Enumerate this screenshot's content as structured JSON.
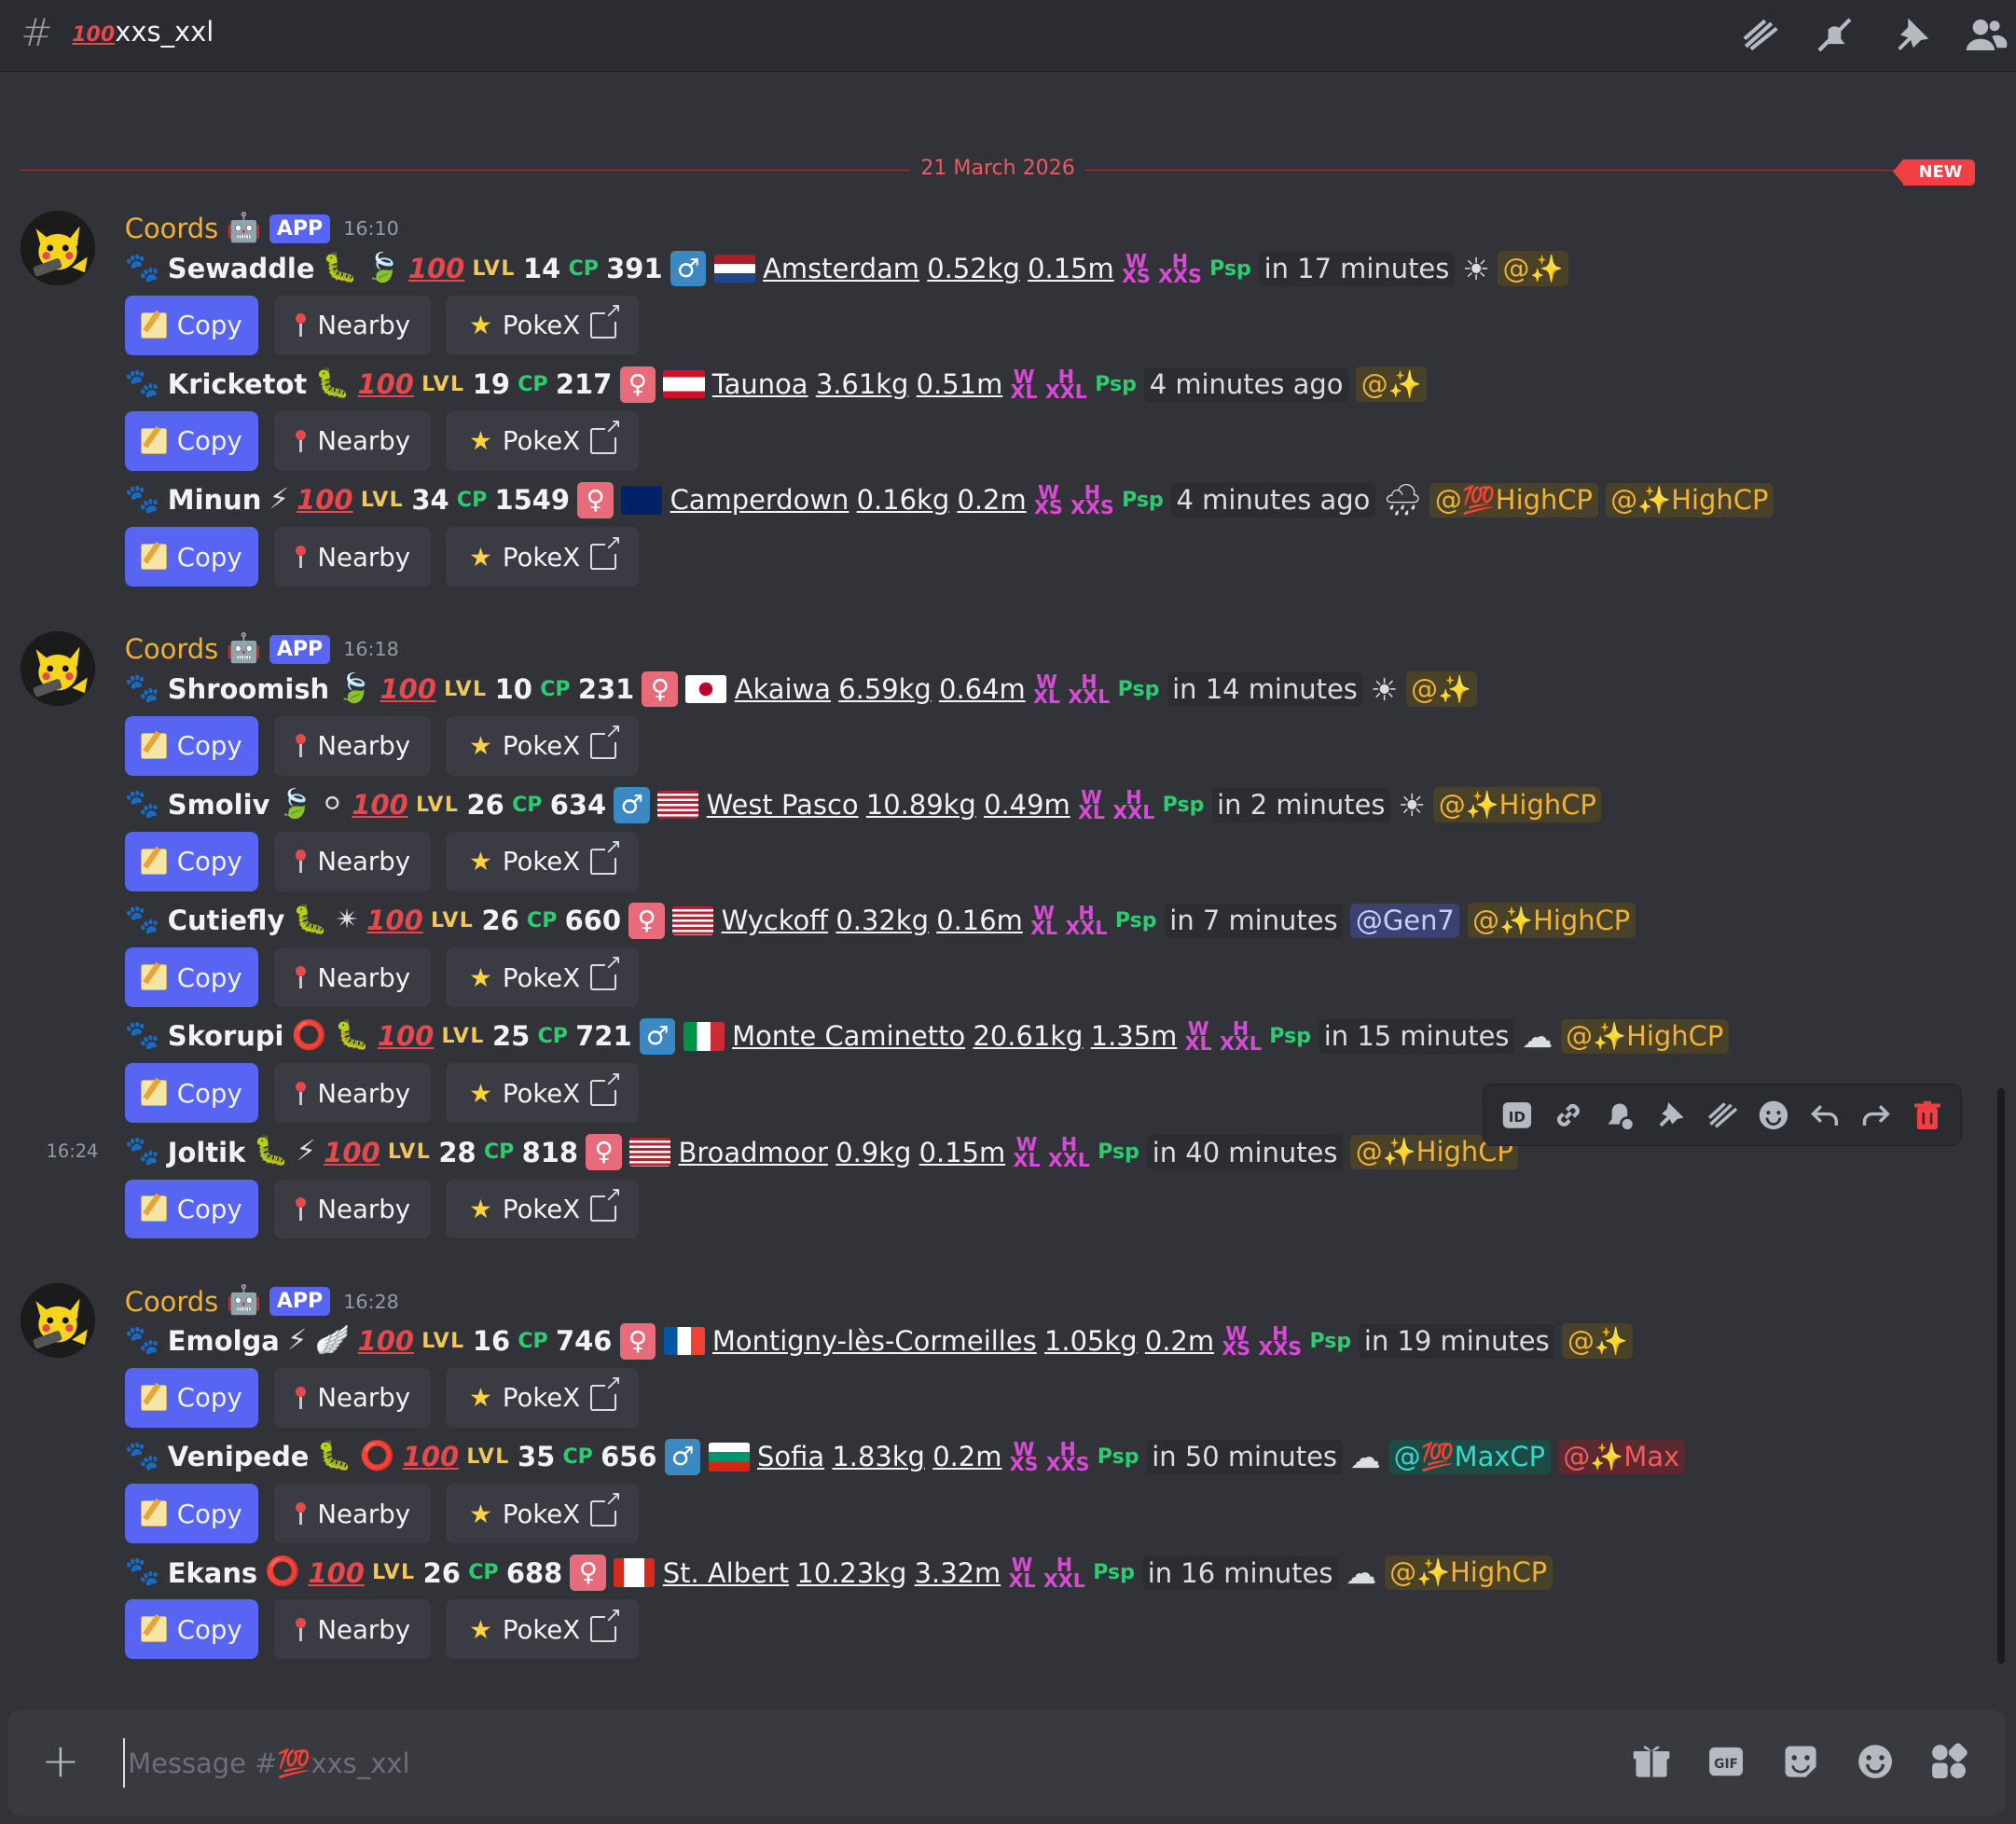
{
  "channel": {
    "hash": "#",
    "emoji": "100",
    "name": "xxs_xxl",
    "placeholder": "Message #💯xxs_xxl"
  },
  "header_icons": [
    "threads-icon",
    "mute-bell-icon",
    "pin-icon",
    "members-icon"
  ],
  "divider": {
    "date": "21 March 2026",
    "new_label": "NEW"
  },
  "labels": {
    "copy": "Copy",
    "nearby": "Nearby",
    "pokex": "PokeX",
    "lvl": "LVL",
    "cp": "CP",
    "app": "APP",
    "author": "Coords"
  },
  "groups": [
    {
      "time": "16:10",
      "messages": [
        {
          "name": "Sewaddle",
          "level": "14",
          "cp": "391",
          "gender": "male",
          "flag": "nl",
          "place": "Amsterdam",
          "weight": "0.52kg",
          "height": "0.15m",
          "size_top": "W",
          "size_bottom": "XS",
          "size2_top": "H",
          "size2_bottom": "XXS",
          "time_text": "in 17 minutes",
          "weather": "☀",
          "mentions": [
            {
              "text": "@✨",
              "style": "gold"
            }
          ],
          "types": [
            "🐛",
            "🍃"
          ]
        },
        {
          "name": "Kricketot",
          "level": "19",
          "cp": "217",
          "gender": "female",
          "flag": "pf",
          "place": "Taunoa",
          "weight": "3.61kg",
          "height": "0.51m",
          "size_top": "W",
          "size_bottom": "XL",
          "size2_top": "H",
          "size2_bottom": "XXL",
          "time_text": "4 minutes ago",
          "weather": "",
          "mentions": [
            {
              "text": "@✨",
              "style": "gold"
            }
          ],
          "types": [
            "🐛"
          ]
        },
        {
          "name": "Minun",
          "level": "34",
          "cp": "1549",
          "gender": "female",
          "flag": "au",
          "place": "Camperdown",
          "weight": "0.16kg",
          "height": "0.2m",
          "size_top": "W",
          "size_bottom": "XS",
          "size2_top": "H",
          "size2_bottom": "XXS",
          "time_text": "4 minutes ago",
          "weather": "🌧",
          "mentions": [
            {
              "text": "@💯HighCP",
              "style": "gold"
            },
            {
              "text": "@✨HighCP",
              "style": "gold"
            }
          ],
          "types": [
            "⚡"
          ]
        }
      ]
    },
    {
      "time": "16:18",
      "messages": [
        {
          "name": "Shroomish",
          "level": "10",
          "cp": "231",
          "gender": "female",
          "flag": "jp",
          "place": "Akaiwa",
          "weight": "6.59kg",
          "height": "0.64m",
          "size_top": "W",
          "size_bottom": "XL",
          "size2_top": "H",
          "size2_bottom": "XXL",
          "time_text": "in 14 minutes",
          "weather": "☀",
          "mentions": [
            {
              "text": "@✨",
              "style": "gold"
            }
          ],
          "types": [
            "🍃"
          ]
        },
        {
          "name": "Smoliv",
          "level": "26",
          "cp": "634",
          "gender": "male",
          "flag": "us",
          "place": "West Pasco",
          "weight": "10.89kg",
          "height": "0.49m",
          "size_top": "W",
          "size_bottom": "XL",
          "size2_top": "H",
          "size2_bottom": "XXL",
          "time_text": "in 2 minutes",
          "weather": "☀",
          "mentions": [
            {
              "text": "@✨HighCP",
              "style": "gold"
            }
          ],
          "types": [
            "🍃",
            "⚪"
          ]
        },
        {
          "name": "Cutiefly",
          "level": "26",
          "cp": "660",
          "gender": "female",
          "flag": "us",
          "place": "Wyckoff",
          "weight": "0.32kg",
          "height": "0.16m",
          "size_top": "W",
          "size_bottom": "XL",
          "size2_top": "H",
          "size2_bottom": "XXL",
          "time_text": "in 7 minutes",
          "weather": "",
          "mentions": [
            {
              "text": "@Gen7",
              "style": "blue"
            },
            {
              "text": "@✨HighCP",
              "style": "gold"
            }
          ],
          "types": [
            "🐛",
            "✴"
          ]
        },
        {
          "name": "Skorupi",
          "level": "25",
          "cp": "721",
          "gender": "male",
          "flag": "it",
          "place": "Monte Caminetto",
          "weight": "20.61kg",
          "height": "1.35m",
          "size_top": "W",
          "size_bottom": "XL",
          "size2_top": "H",
          "size2_bottom": "XXL",
          "time_text": "in 15 minutes",
          "weather": "☁",
          "mentions": [
            {
              "text": "@✨HighCP",
              "style": "gold"
            }
          ],
          "types": [
            "⭕",
            "🐛"
          ]
        },
        {
          "name": "Joltik",
          "level": "28",
          "cp": "818",
          "gender": "female",
          "flag": "us",
          "place": "Broadmoor",
          "weight": "0.9kg",
          "height": "0.15m",
          "size_top": "W",
          "size_bottom": "XL",
          "size2_top": "H",
          "size2_bottom": "XXL",
          "time_text": "in 40 minutes",
          "weather": "",
          "mentions": [
            {
              "text": "@✨HighCP",
              "style": "gold"
            }
          ],
          "types": [
            "🐛",
            "⚡"
          ],
          "hover_time": "16:24"
        }
      ]
    },
    {
      "time": "16:28",
      "messages": [
        {
          "name": "Emolga",
          "level": "16",
          "cp": "746",
          "gender": "female",
          "flag": "fr",
          "place": "Montigny-lès-Cormeilles",
          "weight": "1.05kg",
          "height": "0.2m",
          "size_top": "W",
          "size_bottom": "XS",
          "size2_top": "H",
          "size2_bottom": "XXS",
          "time_text": "in 19 minutes",
          "weather": "",
          "mentions": [
            {
              "text": "@✨",
              "style": "gold"
            }
          ],
          "types": [
            "⚡",
            "🪽"
          ]
        },
        {
          "name": "Venipede",
          "level": "35",
          "cp": "656",
          "gender": "male",
          "flag": "bg",
          "place": "Sofia",
          "weight": "1.83kg",
          "height": "0.2m",
          "size_top": "W",
          "size_bottom": "XS",
          "size2_top": "H",
          "size2_bottom": "XXS",
          "time_text": "in 50 minutes",
          "weather": "☁",
          "mentions": [
            {
              "text": "@💯MaxCP",
              "style": "green"
            },
            {
              "text": "@✨Max",
              "style": "red"
            }
          ],
          "types": [
            "🐛",
            "⭕"
          ]
        },
        {
          "name": "Ekans",
          "level": "26",
          "cp": "688",
          "gender": "female",
          "flag": "ca",
          "place": "St. Albert",
          "weight": "10.23kg",
          "height": "3.32m",
          "size_top": "W",
          "size_bottom": "XL",
          "size2_top": "H",
          "size2_bottom": "XXL",
          "time_text": "in 16 minutes",
          "weather": "☁",
          "mentions": [
            {
              "text": "@✨HighCP",
              "style": "gold"
            }
          ],
          "types": [
            "⭕"
          ]
        }
      ]
    }
  ],
  "toolbar_icons": [
    "id-icon",
    "link-icon",
    "reminder-icon",
    "pin-icon",
    "thread-icon",
    "reaction-icon",
    "reply-icon",
    "forward-icon",
    "delete-icon"
  ],
  "composer_icons": [
    "gift-icon",
    "gif-icon",
    "sticker-icon",
    "emoji-icon",
    "apps-icon"
  ],
  "colors": {
    "background": "#323339",
    "accent": "#5865f2",
    "author": "#f0b232",
    "divider": "#f23f43"
  }
}
